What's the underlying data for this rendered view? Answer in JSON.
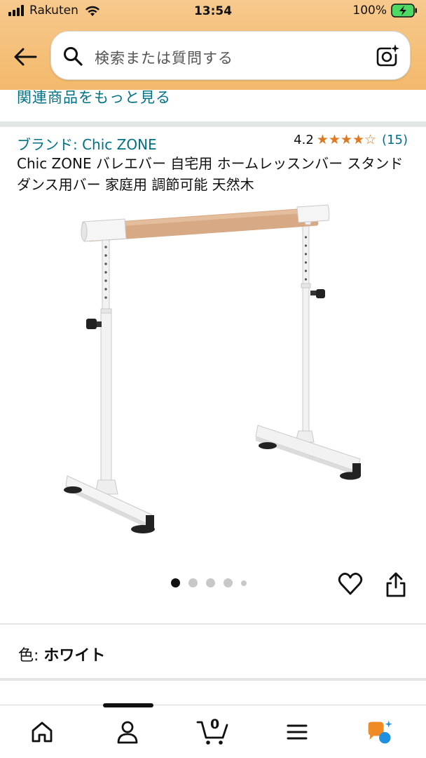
{
  "status_bar": {
    "carrier": "Rakuten",
    "time": "13:54",
    "battery": "100%"
  },
  "search": {
    "placeholder": "検索または質問する"
  },
  "related_link": "関連商品をもっと見る",
  "product": {
    "brand": "ブランド: Chic ZONE",
    "rating": "4.2",
    "stars": [
      "★",
      "★",
      "★",
      "★",
      "☆"
    ],
    "review_count": "(15)",
    "title": "Chic ZONE バレエバー 自宅用 ホームレッスンバー スタンド ダンス用バー 家庭用 調節可能 天然木",
    "image_dots": 5,
    "active_dot": 0
  },
  "variant": {
    "label": "色: ",
    "value": "ホワイト"
  },
  "cart_count": "0",
  "icons": {
    "back": "back-arrow-icon",
    "search": "search-icon",
    "camera": "camera-search-icon",
    "heart": "heart-icon",
    "share": "share-icon",
    "home": "home-icon",
    "account": "account-icon",
    "cart": "cart-icon",
    "menu": "menu-icon",
    "rufus": "rufus-assistant-icon"
  },
  "colors": {
    "link": "#007185",
    "star": "#de7921",
    "header": "#f4b96b",
    "rufus_orange": "#f08a24",
    "rufus_blue": "#1f8fe0"
  }
}
